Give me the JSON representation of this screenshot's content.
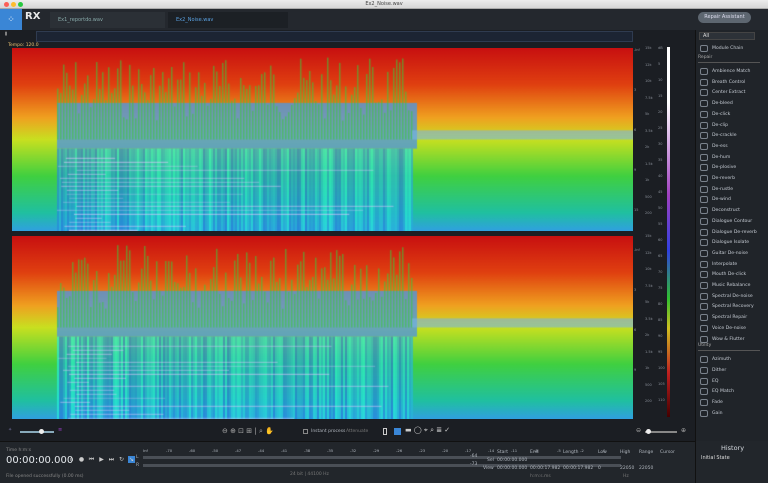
{
  "window": {
    "title": "Ex2_Noise.wav"
  },
  "app": {
    "logo": "RX"
  },
  "tabs": [
    {
      "label": "Ex1_reportdo.wav"
    },
    {
      "label": "Ex2_Noise.wav"
    }
  ],
  "repair_button": "Repair Assistant",
  "tempo": "Tempo: 120.0",
  "panel": {
    "filter": "All",
    "module_chain": "Module Chain",
    "repair_header": "Repair",
    "repair_items": [
      "Ambience Match",
      "Breath Control",
      "Center Extract",
      "De-bleed",
      "De-click",
      "De-clip",
      "De-crackle",
      "De-ess",
      "De-hum",
      "De-plosive",
      "De-reverb",
      "De-rustle",
      "De-wind",
      "Deconstruct",
      "Dialogue Contour",
      "Dialogue De-reverb",
      "Dialogue Isolate",
      "Guitar De-noise",
      "Interpolate",
      "Mouth De-click",
      "Music Rebalance",
      "Spectral De-noise",
      "Spectral Recovery",
      "Spectral Repair",
      "Voice De-noise",
      "Wow & Flutter"
    ],
    "utility_header": "Utility",
    "utility_items": [
      "Azimuth",
      "Dither",
      "EQ",
      "EQ Match",
      "Fade",
      "Gain"
    ]
  },
  "scale": {
    "left": [
      "-Inf",
      "3",
      "6",
      "9",
      "15",
      "-Inf",
      "3",
      "6",
      "9"
    ],
    "hz": [
      "15k",
      "12k",
      "10k",
      "7.5k",
      "5k",
      "3.5k",
      "2k",
      "1.5k",
      "1k",
      "500",
      "200"
    ],
    "db": [
      "dB",
      "5",
      "10",
      "15",
      "20",
      "25",
      "30",
      "35",
      "40",
      "45",
      "50",
      "55",
      "60",
      "65",
      "70",
      "75",
      "80",
      "85",
      "90",
      "95",
      "100",
      "105",
      "110"
    ]
  },
  "toolbar": {
    "instant_process": "Instant process",
    "mode": "Attenuate"
  },
  "transport": {
    "timecode_format": "Time h:m:s",
    "time": "00:00:00.000",
    "status": "File opened successfully (0.00 ms)",
    "meter_ticks": [
      "Inf",
      "-70",
      "-60",
      "-50",
      "-47",
      "-44",
      "-41",
      "-38",
      "-35",
      "-32",
      "-29",
      "-26",
      "-23",
      "-20",
      "-17",
      "-14",
      "-11",
      "-8",
      "-5",
      "-2",
      "0"
    ],
    "meter_values": [
      "-64",
      "-73"
    ],
    "format": "24 bit | 44100 Hz"
  },
  "selection": {
    "headers": [
      "Start",
      "End",
      "Length",
      "Low",
      "High",
      "Range",
      "Cursor"
    ],
    "sel_label": "Sel",
    "view_label": "View",
    "sel_start": "00:00:00.000",
    "view": [
      "00:00:00.000",
      "00:00:17.982",
      "00:00:17.982",
      "0",
      "22050",
      "22050"
    ],
    "time_unit": "h:m:s.ms",
    "freq_unit": "Hz"
  },
  "history": {
    "title": "History",
    "items": [
      "Initial State"
    ]
  },
  "colors": {
    "accent": "#3a86d6",
    "background": "#1b1e23"
  }
}
